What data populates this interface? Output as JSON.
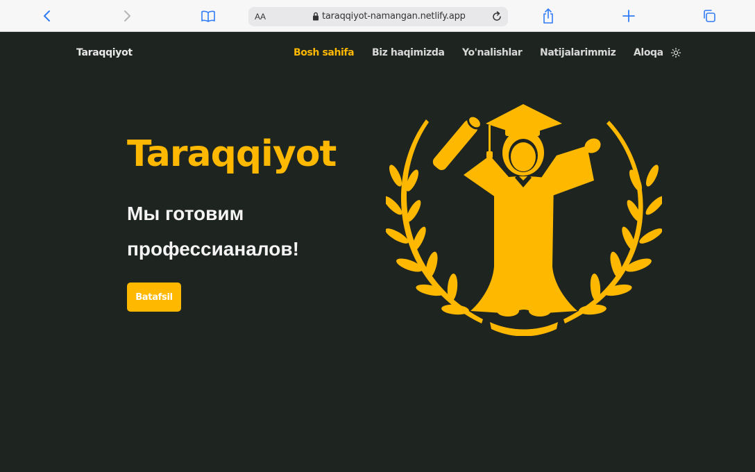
{
  "browser": {
    "text_size_label": "AA",
    "url": "taraqqiyot-namangan.netlify.app",
    "icons": [
      "back-icon",
      "forward-icon",
      "bookmarks-icon",
      "lock-icon",
      "reload-icon",
      "share-icon",
      "new-tab-icon",
      "tabs-icon"
    ]
  },
  "site": {
    "brand": "Taraqqiyot",
    "nav": [
      {
        "label": "Bosh sahifa",
        "active": true
      },
      {
        "label": "Biz haqimizda",
        "active": false
      },
      {
        "label": "Yo'nalishlar",
        "active": false
      },
      {
        "label": "Natijalarimmiz",
        "active": false
      },
      {
        "label": "Aloqa",
        "active": false
      }
    ],
    "theme_toggle_icon": "sun-icon"
  },
  "hero": {
    "title": "Taraqqiyot",
    "subtitle": "Мы готовим профессианалов!",
    "button_label": "Batafsil",
    "illustration": "graduate-laurel-emblem"
  },
  "colors": {
    "accent": "#ffb800",
    "background": "#1e2420",
    "toolbar": "#f7f7f8",
    "icon_blue": "#2f7cf6"
  }
}
